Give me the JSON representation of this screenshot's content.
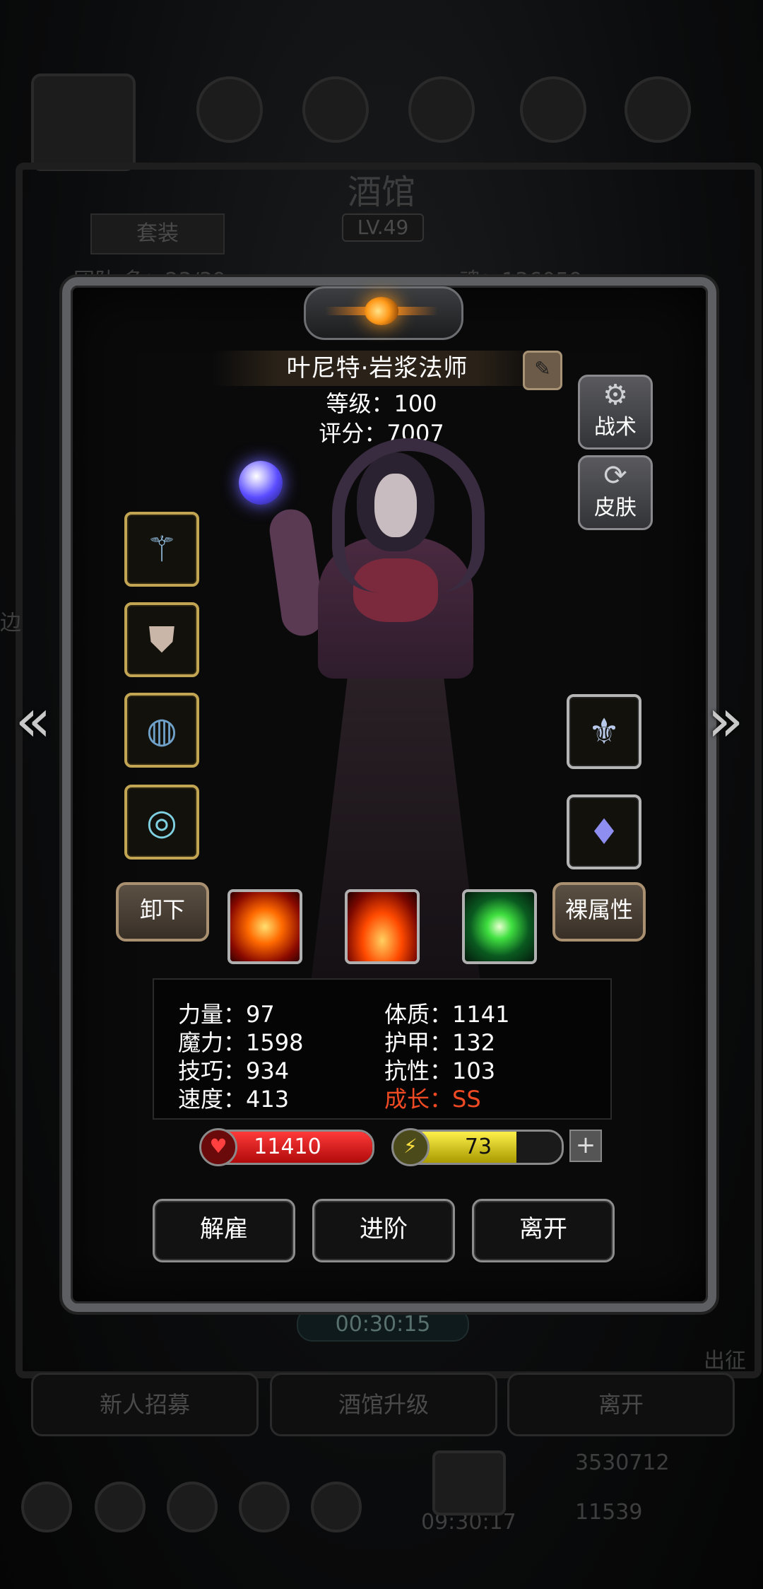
{
  "background": {
    "title": "酒馆",
    "level": "LV.49",
    "tab": "套装",
    "mercenaries": "团队·多：23/39",
    "soul": "魂：136059",
    "side_left": "边",
    "side_right": "出征",
    "timer": "00:30:15",
    "buttons": [
      "新人招募",
      "酒馆升级",
      "离开"
    ],
    "gold": "3530712",
    "gem": "11539",
    "bottom_timer": "09:30:17"
  },
  "hero": {
    "name": "叶尼特·岩浆法师",
    "level_line": "等级：100",
    "score_line": "评分：7007",
    "tactics_label": "战术",
    "skin_label": "皮肤",
    "unequip_label": "卸下",
    "base_attr_label": "裸属性"
  },
  "equipment": {
    "left": [
      "staff-icon",
      "armor-icon",
      "ring-icon",
      "ring-icon"
    ],
    "right": [
      "amulet-icon",
      "necklace-icon"
    ]
  },
  "skills": [
    "fire-burst-icon",
    "flame-icon",
    "green-crystal-icon"
  ],
  "stats": {
    "strength": "力量：97",
    "magic": "魔力：1598",
    "skill": "技巧：934",
    "speed": "速度：413",
    "constitution": "体质：1141",
    "armor": "护甲：132",
    "resistance": "抗性：103",
    "growth": "成长：SS"
  },
  "bars": {
    "hp": "11410",
    "hp_fill": 1.0,
    "energy": "73",
    "energy_fill": 0.73
  },
  "actions": {
    "dismiss": "解雇",
    "advance": "进阶",
    "leave": "离开"
  },
  "colors": {
    "gold_border": "#c2a553",
    "hp": "#d01a1a",
    "energy": "#e8e000",
    "growth": "#f04a24"
  }
}
